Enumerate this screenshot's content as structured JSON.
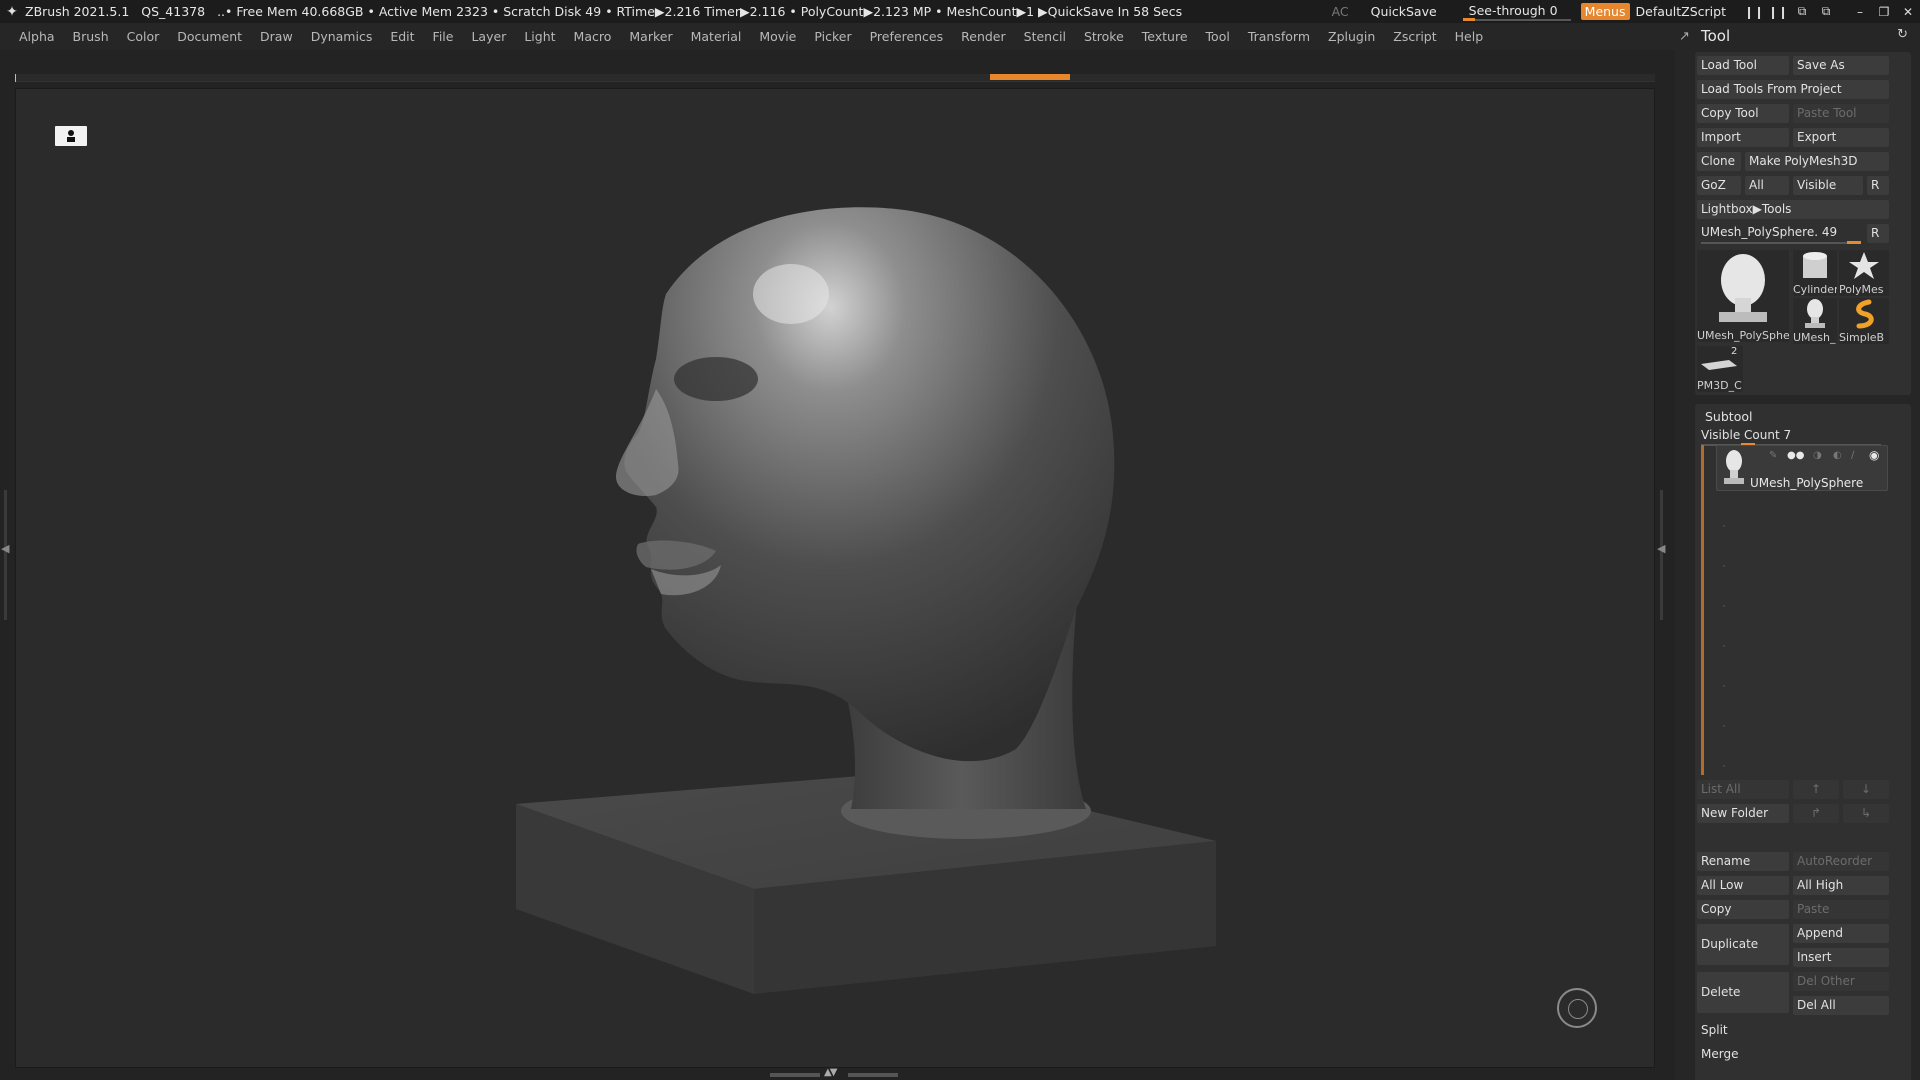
{
  "titlebar": {
    "app": "ZBrush 2021.5.1",
    "qs": "QS_41378",
    "stats": "..• Free Mem 40.668GB • Active Mem 2323 • Scratch Disk 49 •  RTime▶2.216 Timer▶2.116 • PolyCount▶2.123 MP  • MeshCount▶1  ▶QuickSave In 58 Secs",
    "ac": "AC",
    "quicksave": "QuickSave",
    "seethrough": "See-through   0",
    "seethrough_value": 0,
    "menus": "Menus",
    "default_zscript": "DefaultZScript"
  },
  "menubar": {
    "items": [
      "Alpha",
      "Brush",
      "Color",
      "Document",
      "Draw",
      "Dynamics",
      "Edit",
      "File",
      "Layer",
      "Light",
      "Macro",
      "Marker",
      "Material",
      "Movie",
      "Picker",
      "Preferences",
      "Render",
      "Stencil",
      "Stroke",
      "Texture",
      "Tool",
      "Transform",
      "Zplugin",
      "Zscript",
      "Help"
    ]
  },
  "tool_panel": {
    "title": "Tool",
    "buttons": {
      "load_tool": "Load Tool",
      "save_as": "Save As",
      "load_from_project": "Load Tools From Project",
      "copy_tool": "Copy Tool",
      "paste_tool": "Paste Tool",
      "import": "Import",
      "export": "Export",
      "clone": "Clone",
      "make_polymesh": "Make PolyMesh3D",
      "goz": "GoZ",
      "all": "All",
      "visible": "Visible",
      "r": "R",
      "lightbox_tools": "Lightbox▶Tools"
    },
    "current_tool": "UMesh_PolySphere. 49",
    "current_tool_r": "R",
    "thumbnails": {
      "main": "UMesh_PolySphe",
      "cylinder": "Cylinder",
      "polymesh": "PolyMes",
      "umesh_small": "UMesh_",
      "simpleb": "SimpleB",
      "pm3d": "PM3D_C",
      "pm3d_count": "2"
    }
  },
  "subtool": {
    "title": "Subtool",
    "visible_count": "Visible Count 7",
    "visible_count_fraction": 0.25,
    "item_name": "UMesh_PolySphere",
    "buttons": {
      "list_all": "List All",
      "new_folder": "New Folder",
      "rename": "Rename",
      "autoreorder": "AutoReorder",
      "all_low": "All Low",
      "all_high": "All High",
      "copy": "Copy",
      "paste": "Paste",
      "duplicate": "Duplicate",
      "append": "Append",
      "insert": "Insert",
      "delete": "Delete",
      "del_other": "Del Other",
      "del_all": "Del All",
      "split": "Split",
      "merge": "Merge"
    }
  },
  "colors": {
    "accent": "#e6862d",
    "panel": "#262626",
    "viewport": "#2b2b2b"
  }
}
